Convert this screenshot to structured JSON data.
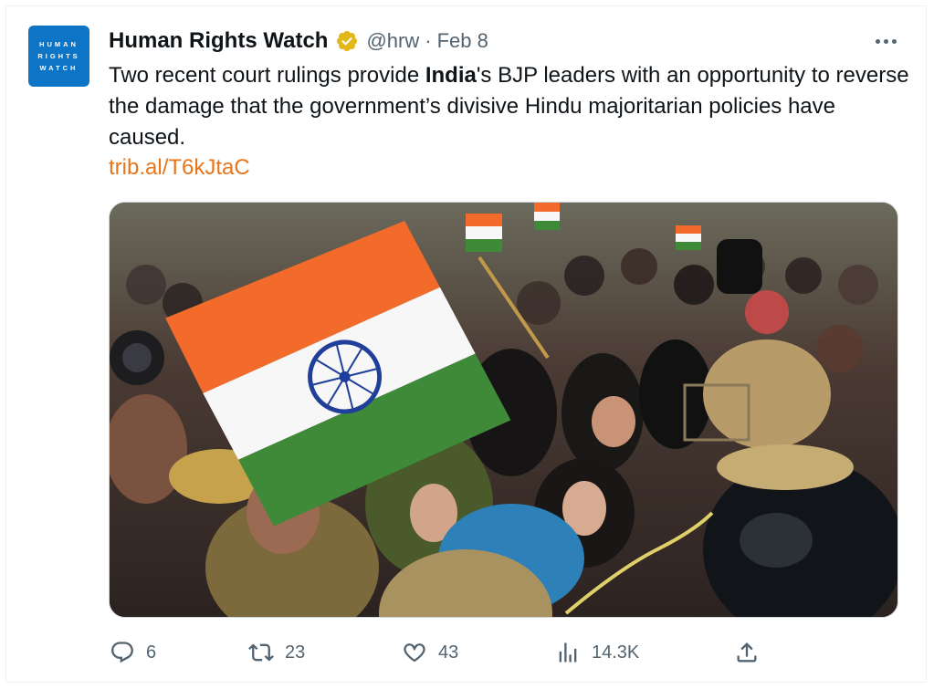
{
  "tweet": {
    "author_name": "Human Rights Watch",
    "avatar_lines": [
      "HUMAN",
      "RIGHTS",
      "WATCH"
    ],
    "handle": "@hrw",
    "separator": "·",
    "date": "Feb 8",
    "text_before": "Two recent court rulings provide ",
    "text_bold": "India",
    "text_after": "'s BJP leaders with an opportunity to reverse the damage that the government’s divisive Hindu majoritarian policies have caused.",
    "link": "trib.al/T6kJtaC",
    "verified_color": "#e2b719",
    "link_color": "#e8751a"
  },
  "actions": {
    "replies": "6",
    "retweets": "23",
    "likes": "43",
    "views": "14.3K"
  },
  "icons": [
    "verified-badge-icon",
    "more-icon",
    "reply-icon",
    "retweet-icon",
    "like-icon",
    "views-icon",
    "share-icon"
  ]
}
